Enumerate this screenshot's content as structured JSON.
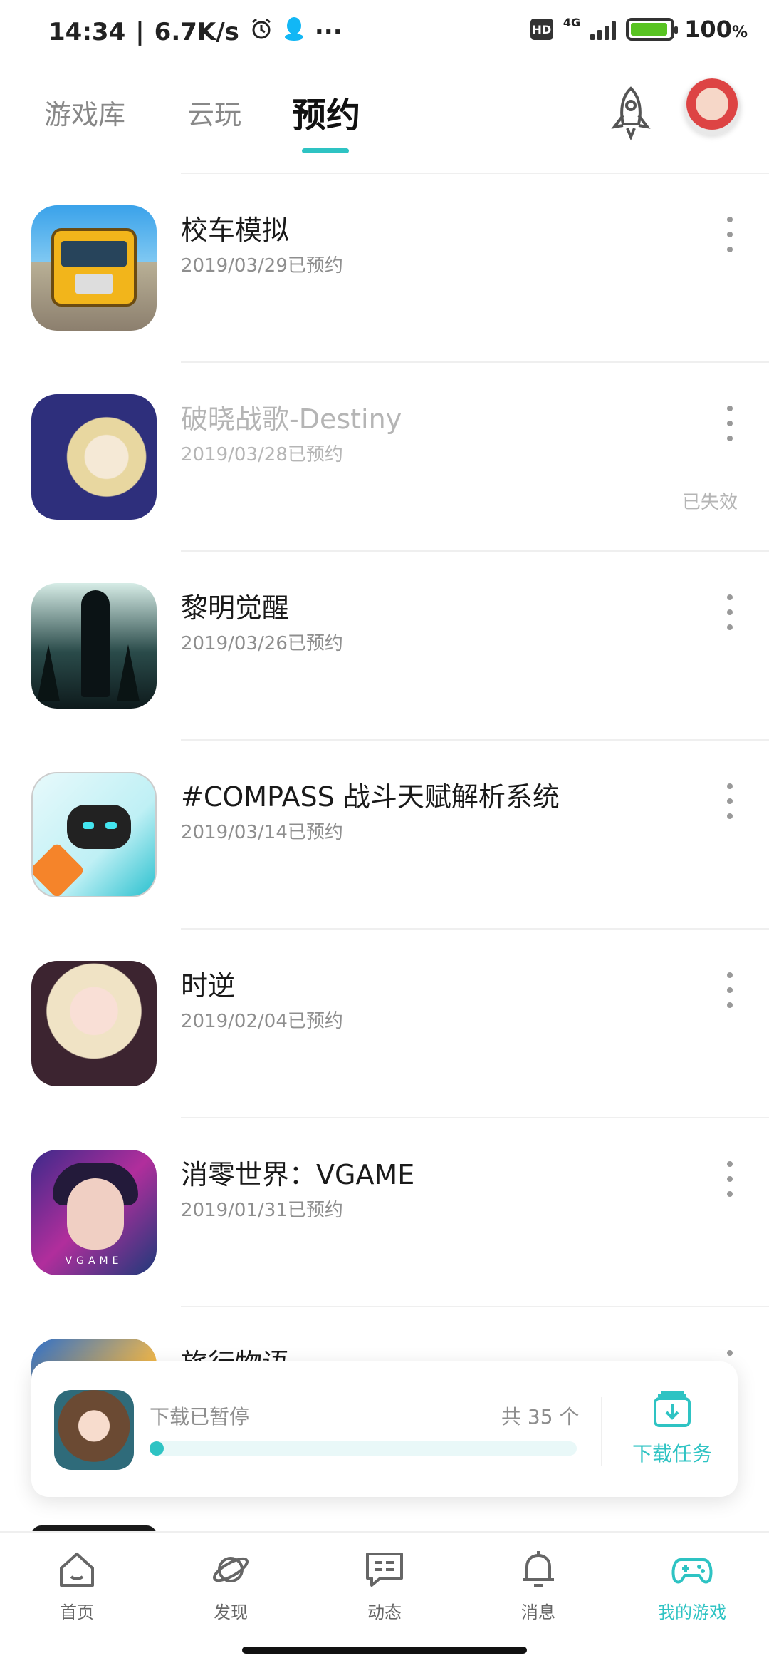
{
  "status_bar": {
    "time": "14:34",
    "network_speed": "6.7K/s",
    "more": "···",
    "hd": "HD",
    "network_type": "4G",
    "battery_percent": "100",
    "battery_unit": "%"
  },
  "top_tabs": {
    "tabs": [
      {
        "label": "游戏库",
        "active": false
      },
      {
        "label": "云玩",
        "active": false
      },
      {
        "label": "预约",
        "active": true
      }
    ]
  },
  "game_list": {
    "items": [
      {
        "title": "校车模拟",
        "date": "2019/03/29已预约",
        "expired": false,
        "icon": "school-bus-game-icon"
      },
      {
        "title": "破晓战歌-Destiny",
        "date": "2019/03/28已预约",
        "expired": true,
        "expired_label": "已失效",
        "icon": "destiny-game-icon"
      },
      {
        "title": "黎明觉醒",
        "date": "2019/03/26已预约",
        "expired": false,
        "icon": "dawn-awakening-game-icon"
      },
      {
        "title": "#COMPASS 战斗天赋解析系统",
        "date": "2019/03/14已预约",
        "expired": false,
        "icon": "compass-game-icon"
      },
      {
        "title": "时逆",
        "date": "2019/02/04已预约",
        "expired": false,
        "icon": "shini-game-icon"
      },
      {
        "title": "消零世界：VGAME",
        "date": "2019/01/31已预约",
        "expired": false,
        "icon": "vgame-game-icon",
        "icon_text": "VGAME"
      },
      {
        "title": "旅行物语",
        "date": "",
        "expired": false,
        "icon": "travel-game-icon"
      }
    ]
  },
  "download_card": {
    "status": "下载已暂停",
    "count_label": "共 35 个",
    "progress": 0.0,
    "task_label": "下载任务"
  },
  "bottom_nav": {
    "items": [
      {
        "label": "首页",
        "icon": "home-icon",
        "active": false
      },
      {
        "label": "发现",
        "icon": "planet-icon",
        "active": false
      },
      {
        "label": "动态",
        "icon": "chat-icon",
        "active": false
      },
      {
        "label": "消息",
        "icon": "bell-icon",
        "active": false
      },
      {
        "label": "我的游戏",
        "icon": "gamepad-icon",
        "active": true
      }
    ]
  },
  "colors": {
    "accent": "#2ec3c3",
    "muted_text": "#8e8e8e",
    "expired_text": "#b5b5b5"
  }
}
